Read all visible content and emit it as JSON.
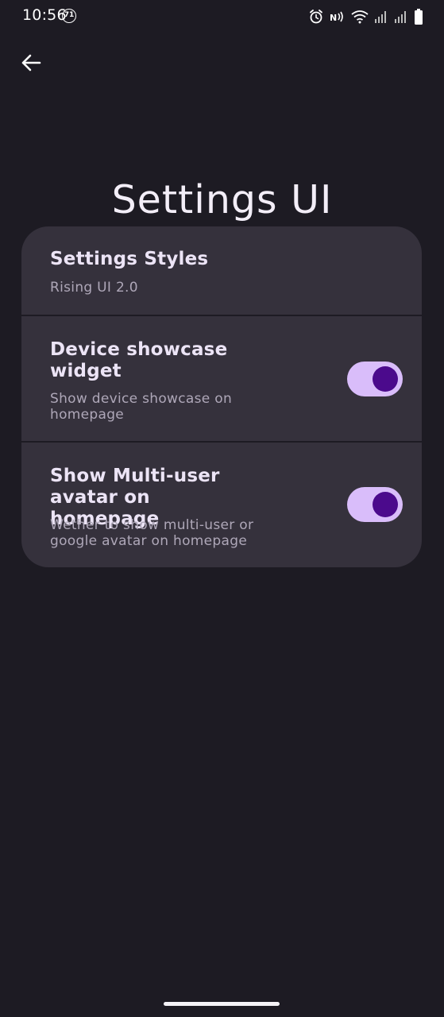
{
  "status_bar": {
    "time": "10:56",
    "notification_count": "71",
    "icons": [
      "alarm-icon",
      "nfc-icon",
      "wifi-icon",
      "signal-icon",
      "signal-icon",
      "battery-icon"
    ]
  },
  "header": {
    "back_icon": "arrow-left-icon",
    "title": "Settings UI"
  },
  "settings": {
    "items": [
      {
        "title": "Settings Styles",
        "subtitle": "Rising UI 2.0"
      },
      {
        "title": "Device showcase widget",
        "subtitle": "Show device showcase on homepage",
        "toggle_on": true
      },
      {
        "title": "Show Multi-user avatar on homepage",
        "subtitle": "Wether to show multi-user or google avatar on homepage",
        "toggle_on": true
      }
    ]
  },
  "colors": {
    "background": "#1d1b23",
    "card": "#35313c",
    "toggle_track": "#d9bdfa",
    "toggle_knob": "#4b0a8c"
  }
}
